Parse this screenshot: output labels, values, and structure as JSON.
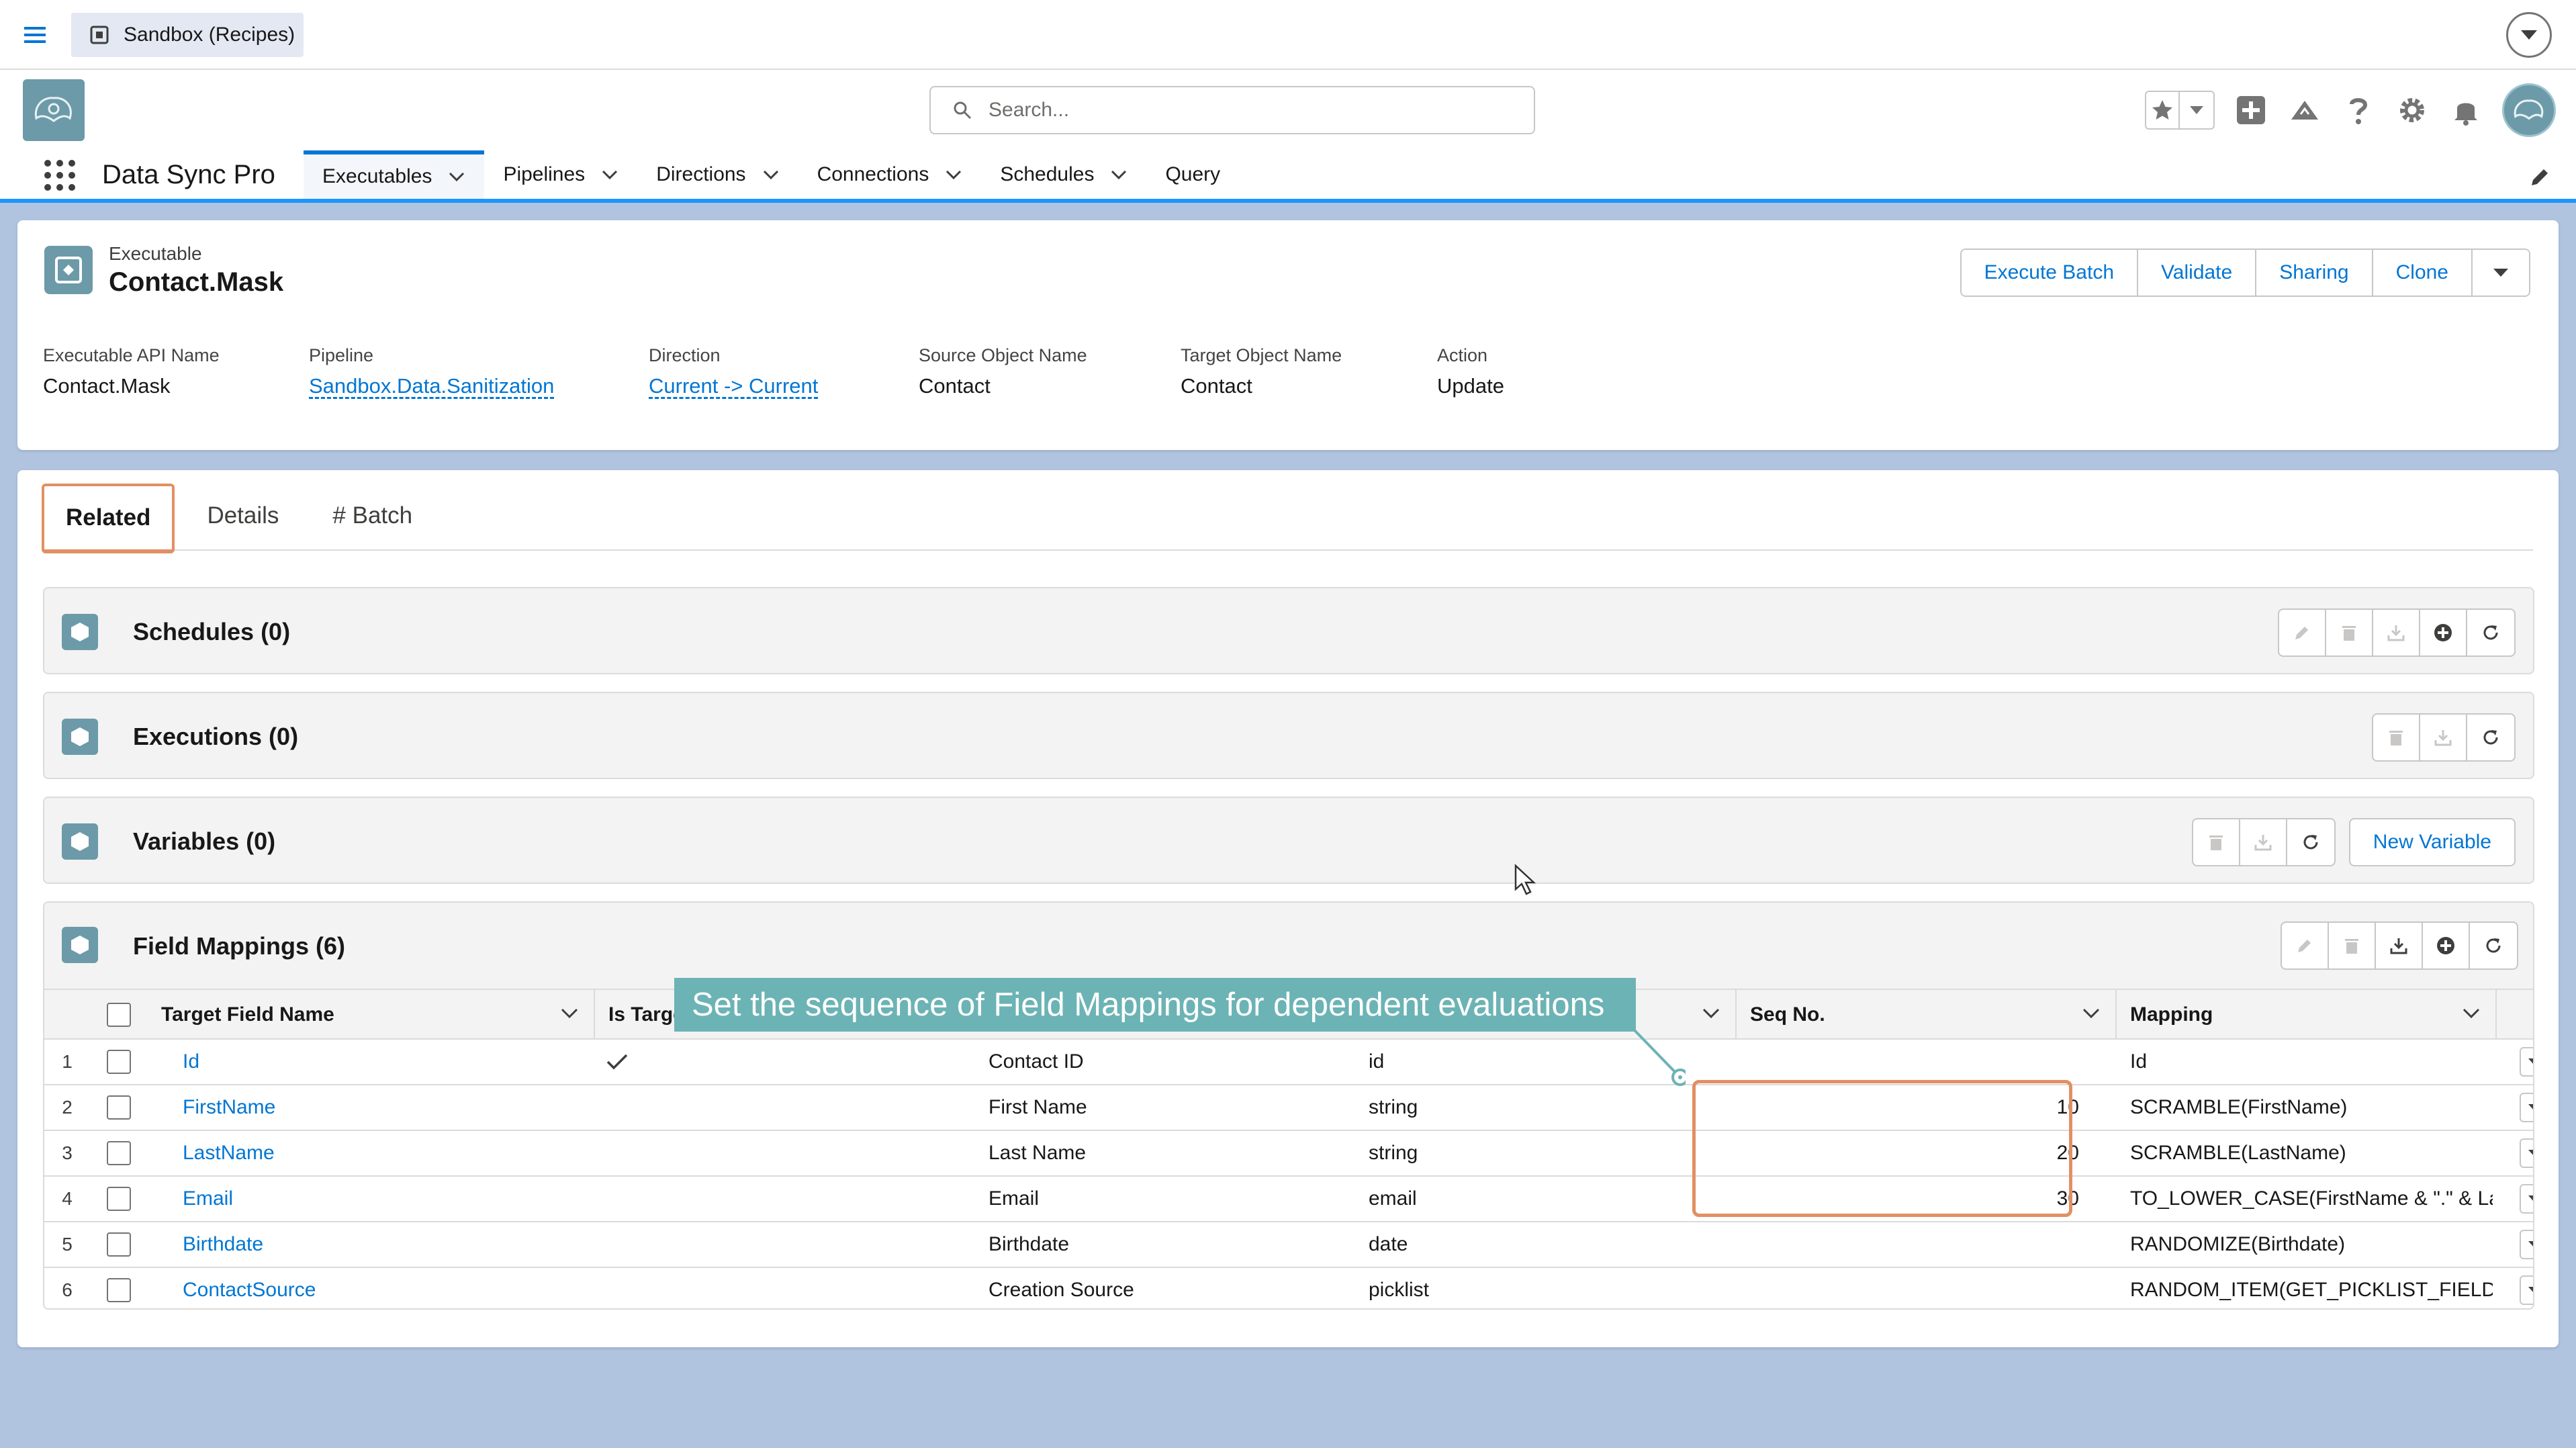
{
  "topbar": {
    "app_tab_label": "Sandbox (Recipes)"
  },
  "header": {
    "search_placeholder": "Search..."
  },
  "nav": {
    "app_name": "Data Sync Pro",
    "items": [
      {
        "label": "Executables",
        "has_menu": true,
        "active": true
      },
      {
        "label": "Pipelines",
        "has_menu": true
      },
      {
        "label": "Directions",
        "has_menu": true
      },
      {
        "label": "Connections",
        "has_menu": true
      },
      {
        "label": "Schedules",
        "has_menu": true
      },
      {
        "label": "Query",
        "has_menu": false
      }
    ]
  },
  "record": {
    "type": "Executable",
    "title": "Contact.Mask",
    "buttons": [
      "Execute Batch",
      "Validate",
      "Sharing",
      "Clone"
    ],
    "fields": [
      {
        "label": "Executable API Name",
        "value": "Contact.Mask",
        "link": false
      },
      {
        "label": "Pipeline",
        "value": "Sandbox.Data.Sanitization",
        "link": true
      },
      {
        "label": "Direction",
        "value": "Current -> Current",
        "link": true
      },
      {
        "label": "Source Object Name",
        "value": "Contact",
        "link": false
      },
      {
        "label": "Target Object Name",
        "value": "Contact",
        "link": false
      },
      {
        "label": "Action",
        "value": "Update",
        "link": false
      }
    ]
  },
  "tabs": [
    "Related",
    "Details",
    "# Batch"
  ],
  "sections": {
    "schedules": "Schedules (0)",
    "executions": "Executions (0)",
    "variables": "Variables (0)",
    "new_variable": "New Variable",
    "field_mappings": "Field Mappings (6)"
  },
  "table": {
    "headers": {
      "target_field": "Target Field Name",
      "is_target": "Is Target Ma",
      "seq": "Seq No.",
      "mapping": "Mapping"
    },
    "rows": [
      {
        "n": "1",
        "field": "Id",
        "is_target": true,
        "label": "Contact ID",
        "type": "id",
        "seq": "",
        "mapping": "Id"
      },
      {
        "n": "2",
        "field": "FirstName",
        "is_target": false,
        "label": "First Name",
        "type": "string",
        "seq": "10",
        "mapping": "SCRAMBLE(FirstName)"
      },
      {
        "n": "3",
        "field": "LastName",
        "is_target": false,
        "label": "Last Name",
        "type": "string",
        "seq": "20",
        "mapping": "SCRAMBLE(LastName)"
      },
      {
        "n": "4",
        "field": "Email",
        "is_target": false,
        "label": "Email",
        "type": "email",
        "seq": "30",
        "mapping": "TO_LOWER_CASE(FirstName & \".\" & La..."
      },
      {
        "n": "5",
        "field": "Birthdate",
        "is_target": false,
        "label": "Birthdate",
        "type": "date",
        "seq": "",
        "mapping": "RANDOMIZE(Birthdate)"
      },
      {
        "n": "6",
        "field": "ContactSource",
        "is_target": false,
        "label": "Creation Source",
        "type": "picklist",
        "seq": "",
        "mapping": "RANDOM_ITEM(GET_PICKLIST_FIELD_O..."
      }
    ]
  },
  "callout": {
    "text": "Set the sequence of Field Mappings for dependent evaluations"
  },
  "colors": {
    "brand_blue": "#0176d3",
    "callout_teal": "#6cb3b5",
    "highlight_orange": "#e28f63",
    "app_icon": "#6c9aa8"
  }
}
